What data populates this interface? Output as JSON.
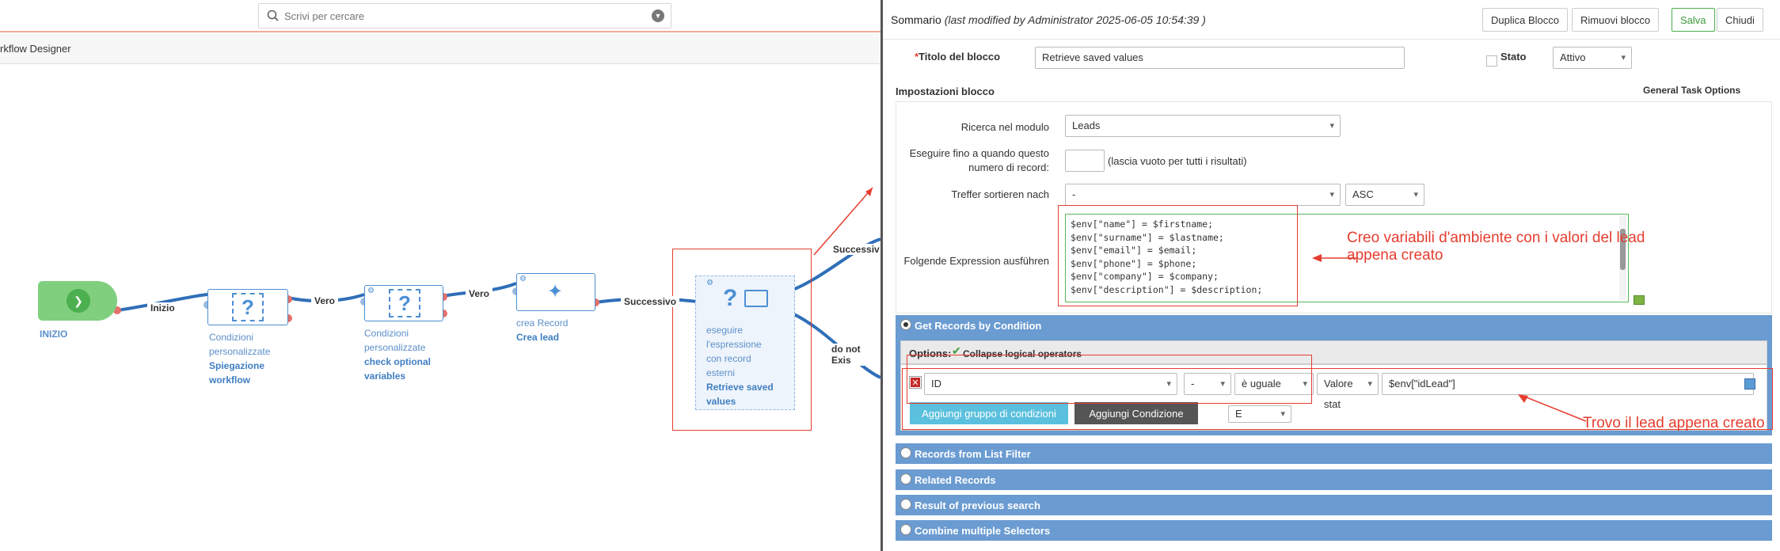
{
  "search": {
    "placeholder": "Scrivi per cercare"
  },
  "breadcrumb": {
    "label": "rkflow Designer"
  },
  "workflow": {
    "start_label": "INIZIO",
    "edges": {
      "inizio": "Inizio",
      "vero1": "Vero",
      "vero2": "Vero",
      "successivo": "Successivo",
      "successivo2": "Successiv",
      "do_not_exist": "do not Exis"
    },
    "nodes": [
      {
        "line1": "Condizioni",
        "line2": "personalizzate",
        "bold1": "Spiegazione",
        "bold2": "workflow"
      },
      {
        "line1": "Condizioni",
        "line2": "personalizzate",
        "bold1": "check optional",
        "bold2": "variables"
      },
      {
        "line1": "crea Record",
        "bold1": "Crea lead"
      },
      {
        "line1": "eseguire",
        "line2": "l'espressione",
        "line3": "con record",
        "line4": "esterni",
        "bold1": "Retrieve saved",
        "bold2": "values"
      }
    ]
  },
  "panel": {
    "title": "Sommario",
    "modified": "(last modified by Administrator 2025-06-05 10:54:39 )",
    "buttons": {
      "duplicate": "Duplica Blocco",
      "remove": "Rimuovi blocco",
      "save": "Salva",
      "close": "Chiudi"
    },
    "block_title_label": "Titolo del blocco",
    "block_title_value": "Retrieve saved values",
    "required_mark": "*",
    "state_label": "Stato",
    "state_value": "Attivo",
    "settings_heading": "Impostazioni blocco",
    "general_task_options": "General Task Options",
    "search_module_label": "Ricerca nel modulo",
    "search_module_value": "Leads",
    "limit_label_1": "Eseguire fino a quando questo",
    "limit_label_2": "numero di record:",
    "limit_hint": "(lascia vuoto per tutti i risultati)",
    "sort_label": "Treffer sortieren nach",
    "sort_value": "-",
    "sort_dir": "ASC",
    "expression_label": "Folgende Expression ausführen",
    "expression": "$env[\"name\"] = $firstname;\n$env[\"surname\"] = $lastname;\n$env[\"email\"] = $email;\n$env[\"phone\"] = $phone;\n$env[\"company\"] = $company;\n$env[\"description\"] = $description;",
    "annotation_env_1": "Creo variabili d'ambiente con i valori del lead",
    "annotation_env_2": "appena creato",
    "annotation_find": "Trovo il lead appena creato",
    "sections": {
      "get_records": "Get Records by Condition",
      "list_filter": "Records from List Filter",
      "related": "Related Records",
      "previous": "Result of previous search",
      "combine": "Combine multiple Selectors"
    },
    "options_label": "Options:",
    "collapse_label": "Collapse logical operators",
    "condition": {
      "field": "ID",
      "op1": "-",
      "op2": "è uguale",
      "type": "Valore stat",
      "value": "$env[\"idLead\"]"
    },
    "add_group": "Aggiungi gruppo di condizioni",
    "add_condition": "Aggiungi Condizione",
    "join_value": "E"
  }
}
